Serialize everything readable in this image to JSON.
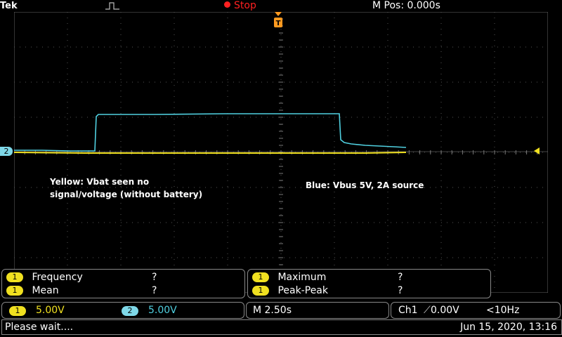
{
  "topbar": {
    "brand": "Tek",
    "status": "Stop",
    "mpos": "M Pos: 0.000s"
  },
  "screen": {
    "ch2_marker": "2",
    "trigger_marker": "T",
    "annotations": {
      "yellow": "Yellow: Vbat seen no signal/voltage (without battery)",
      "blue": "Blue: Vbus 5V, 2A source"
    }
  },
  "measurements": {
    "left": [
      {
        "ch": "1",
        "name": "Frequency",
        "value": "?"
      },
      {
        "ch": "1",
        "name": "Mean",
        "value": "?"
      }
    ],
    "right": [
      {
        "ch": "1",
        "name": "Maximum",
        "value": "?"
      },
      {
        "ch": "1",
        "name": "Peak-Peak",
        "value": "?"
      }
    ]
  },
  "scales": {
    "ch1_badge": "1",
    "ch1_scale": "5.00V",
    "ch2_badge": "2",
    "ch2_scale": "5.00V",
    "timebase": "M 2.50s",
    "trigger": "Ch1",
    "trigger_level": "0.00V",
    "trigger_freq": "<10Hz"
  },
  "statusline": {
    "message": "Please wait....",
    "datetime": "Jun 15, 2020, 13:16"
  },
  "colors": {
    "ch1": "#f0e020",
    "ch2": "#50d0e0",
    "stop": "#ff2020",
    "trigger_marker": "#ff9a20"
  }
}
